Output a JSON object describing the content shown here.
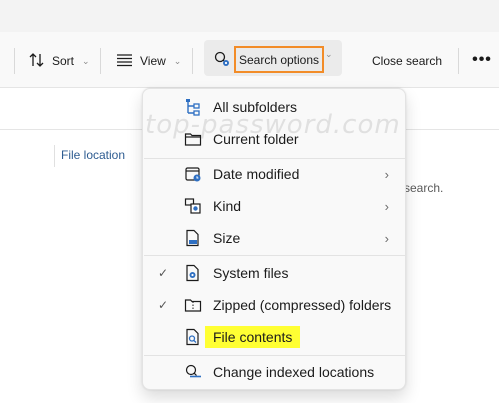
{
  "toolbar": {
    "sort_label": "Sort",
    "view_label": "View",
    "search_options_label": "Search options",
    "close_search_label": "Close search",
    "more_label": "•••"
  },
  "column_header": "File location",
  "background_text": "search.",
  "watermark": "top-password.com",
  "menu": {
    "all_subfolders": "All subfolders",
    "current_folder": "Current folder",
    "date_modified": "Date modified",
    "kind": "Kind",
    "size": "Size",
    "system_files": "System files",
    "zipped_folders": "Zipped (compressed) folders",
    "file_contents": "File contents",
    "change_indexed": "Change indexed locations"
  },
  "state": {
    "system_files_checked": true,
    "zipped_folders_checked": true,
    "file_contents_checked": false
  },
  "colors": {
    "highlight": "#ffff33",
    "focus_outline": "#f28c28",
    "icon_blue": "#2e6fc2"
  },
  "glyphs": {
    "check": "✓",
    "chevron_right": "›",
    "chevron_down": "⌄"
  }
}
